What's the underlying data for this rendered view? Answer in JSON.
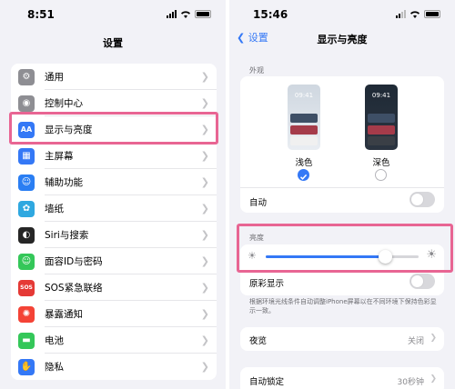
{
  "left": {
    "status_time": "8:51",
    "title": "设置",
    "items": [
      {
        "label": "通用",
        "icon": "gear-icon",
        "color": "#8e8e93",
        "glyph": "⚙"
      },
      {
        "label": "控制中心",
        "icon": "toggles-icon",
        "color": "#8e8e93",
        "glyph": "◉"
      },
      {
        "label": "显示与亮度",
        "icon": "display-icon",
        "color": "#3478f6",
        "glyph": "AA"
      },
      {
        "label": "主屏幕",
        "icon": "home-screen-icon",
        "color": "#3478f6",
        "glyph": "▦"
      },
      {
        "label": "辅助功能",
        "icon": "accessibility-icon",
        "color": "#2a7ef3",
        "glyph": "☺"
      },
      {
        "label": "墙纸",
        "icon": "wallpaper-icon",
        "color": "#2fa8e0",
        "glyph": "✿"
      },
      {
        "label": "Siri与搜索",
        "icon": "siri-icon",
        "color": "#262626",
        "glyph": "◐"
      },
      {
        "label": "面容ID与密码",
        "icon": "faceid-icon",
        "color": "#34c759",
        "glyph": "☺"
      },
      {
        "label": "SOS紧急联络",
        "icon": "sos-icon",
        "color": "#e53935",
        "glyph": "SOS"
      },
      {
        "label": "暴露通知",
        "icon": "exposure-icon",
        "color": "#f44336",
        "glyph": "✺"
      },
      {
        "label": "电池",
        "icon": "battery-icon",
        "color": "#34c759",
        "glyph": "▬"
      },
      {
        "label": "隐私",
        "icon": "privacy-hand-icon",
        "color": "#3478f6",
        "glyph": "✋"
      }
    ]
  },
  "right": {
    "status_time": "15:46",
    "back_label": "设置",
    "title": "显示与亮度",
    "appearance_label": "外观",
    "phone_time_light": "09:41",
    "phone_time_dark": "09:41",
    "light_label": "浅色",
    "dark_label": "深色",
    "auto_label": "自动",
    "auto_toggle": false,
    "brightness_label": "亮度",
    "brightness_level": 0.78,
    "truetone_label": "原彩显示",
    "truetone_toggle": false,
    "truetone_desc": "根据环境光线条件自动调整iPhone屏幕以在不同环境下保持色彩显示一致。",
    "nightshift_label": "夜览",
    "nightshift_value": "关闭",
    "autolock_label": "自动锁定",
    "autolock_value": "30秒钟"
  },
  "colors": {
    "accent": "#3478f6",
    "highlight": "#e86593"
  }
}
